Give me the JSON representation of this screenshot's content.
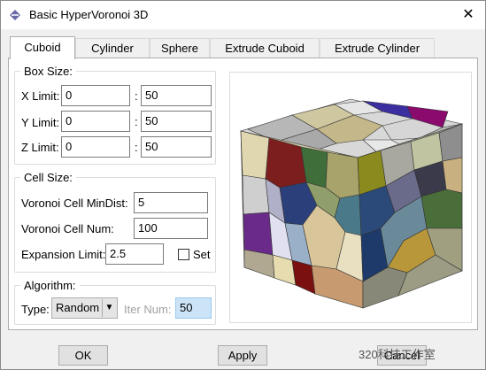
{
  "window": {
    "title": "Basic HyperVoronoi 3D",
    "close_glyph": "✕"
  },
  "tabs": [
    {
      "label": "Cuboid",
      "active": true
    },
    {
      "label": "Cylinder",
      "active": false
    },
    {
      "label": "Sphere",
      "active": false
    },
    {
      "label": "Extrude Cuboid",
      "active": false
    },
    {
      "label": "Extrude Cylinder",
      "active": false
    }
  ],
  "box_size": {
    "legend": "Box Size:",
    "separator": ":",
    "x": {
      "label": "X Limit:",
      "min": "0",
      "max": "50"
    },
    "y": {
      "label": "Y Limit:",
      "min": "0",
      "max": "50"
    },
    "z": {
      "label": "Z Limit:",
      "min": "0",
      "max": "50"
    }
  },
  "cell_size": {
    "legend": "Cell Size:",
    "min_dist": {
      "label": "Voronoi Cell MinDist:",
      "value": "5"
    },
    "cell_num": {
      "label": "Voronoi Cell Num:",
      "value": "100"
    },
    "expansion": {
      "label": "Expansion Limit:",
      "value": "2.5"
    },
    "set_label": "Set",
    "set_checked": false
  },
  "algorithm": {
    "legend": "Algorithm:",
    "type_label": "Type:",
    "type_value": "Random",
    "iter_label": "Iter Num:",
    "iter_value": "50"
  },
  "buttons": {
    "ok": "OK",
    "apply": "Apply",
    "cancel": "Cancel"
  },
  "watermark": "320科技工作室",
  "icons": {
    "app": "app-icon",
    "close": "close-icon",
    "dropdown": "chevron-down-icon"
  },
  "colors": {
    "window_bg": "#f0f0f0",
    "panel_bg": "#ffffff",
    "disabled_field": "#cce4f7"
  }
}
